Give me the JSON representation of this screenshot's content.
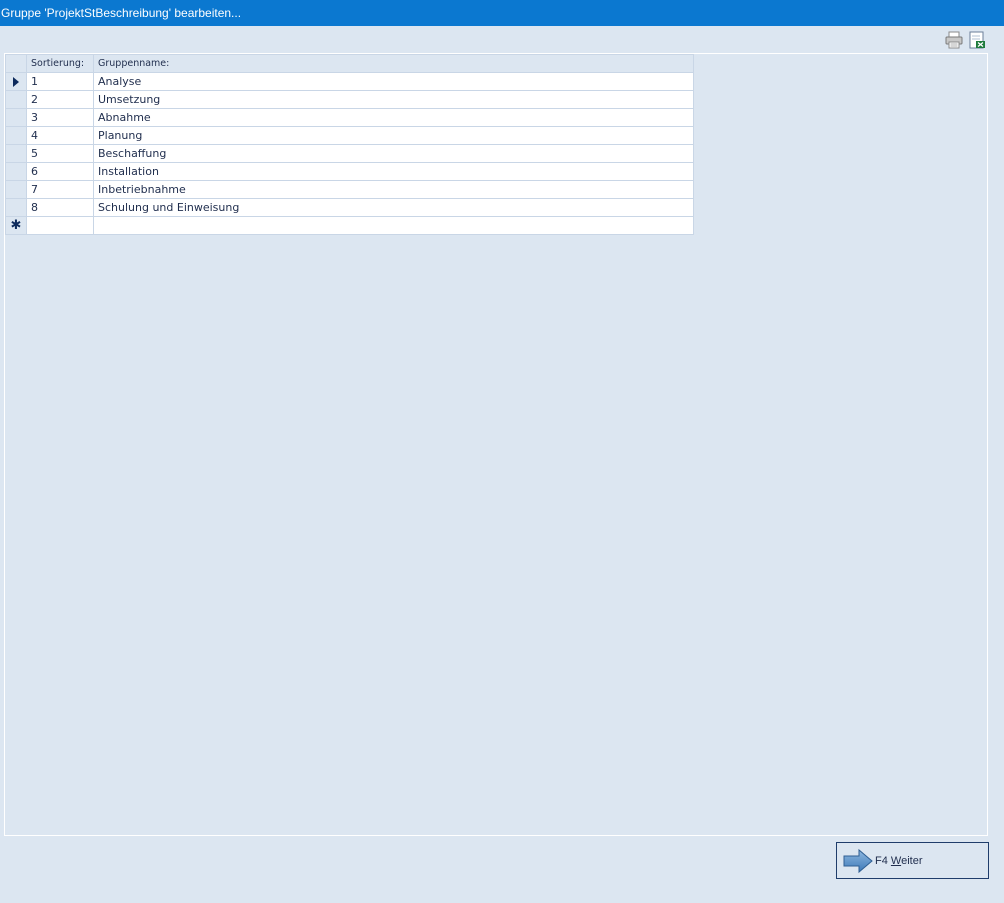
{
  "window": {
    "title": "Gruppe 'ProjektStBeschreibung' bearbeiten..."
  },
  "toolbar": {
    "print_icon": "printer-icon",
    "export_icon": "excel-export-icon"
  },
  "grid": {
    "columns": [
      "Sortierung:",
      "Gruppenname:"
    ],
    "rows": [
      {
        "sort": "1",
        "name": "Analyse"
      },
      {
        "sort": "2",
        "name": "Umsetzung"
      },
      {
        "sort": "3",
        "name": "Abnahme"
      },
      {
        "sort": "4",
        "name": "Planung"
      },
      {
        "sort": "5",
        "name": "Beschaffung"
      },
      {
        "sort": "6",
        "name": "Installation"
      },
      {
        "sort": "7",
        "name": "Inbetriebnahme"
      },
      {
        "sort": "8",
        "name": "Schulung und Einweisung"
      }
    ],
    "current_row_indicator": "arrow",
    "new_row_indicator": "✱"
  },
  "footer": {
    "weiter_prefix": "F4 ",
    "weiter_mnemonic": "W",
    "weiter_rest": "eiter"
  }
}
